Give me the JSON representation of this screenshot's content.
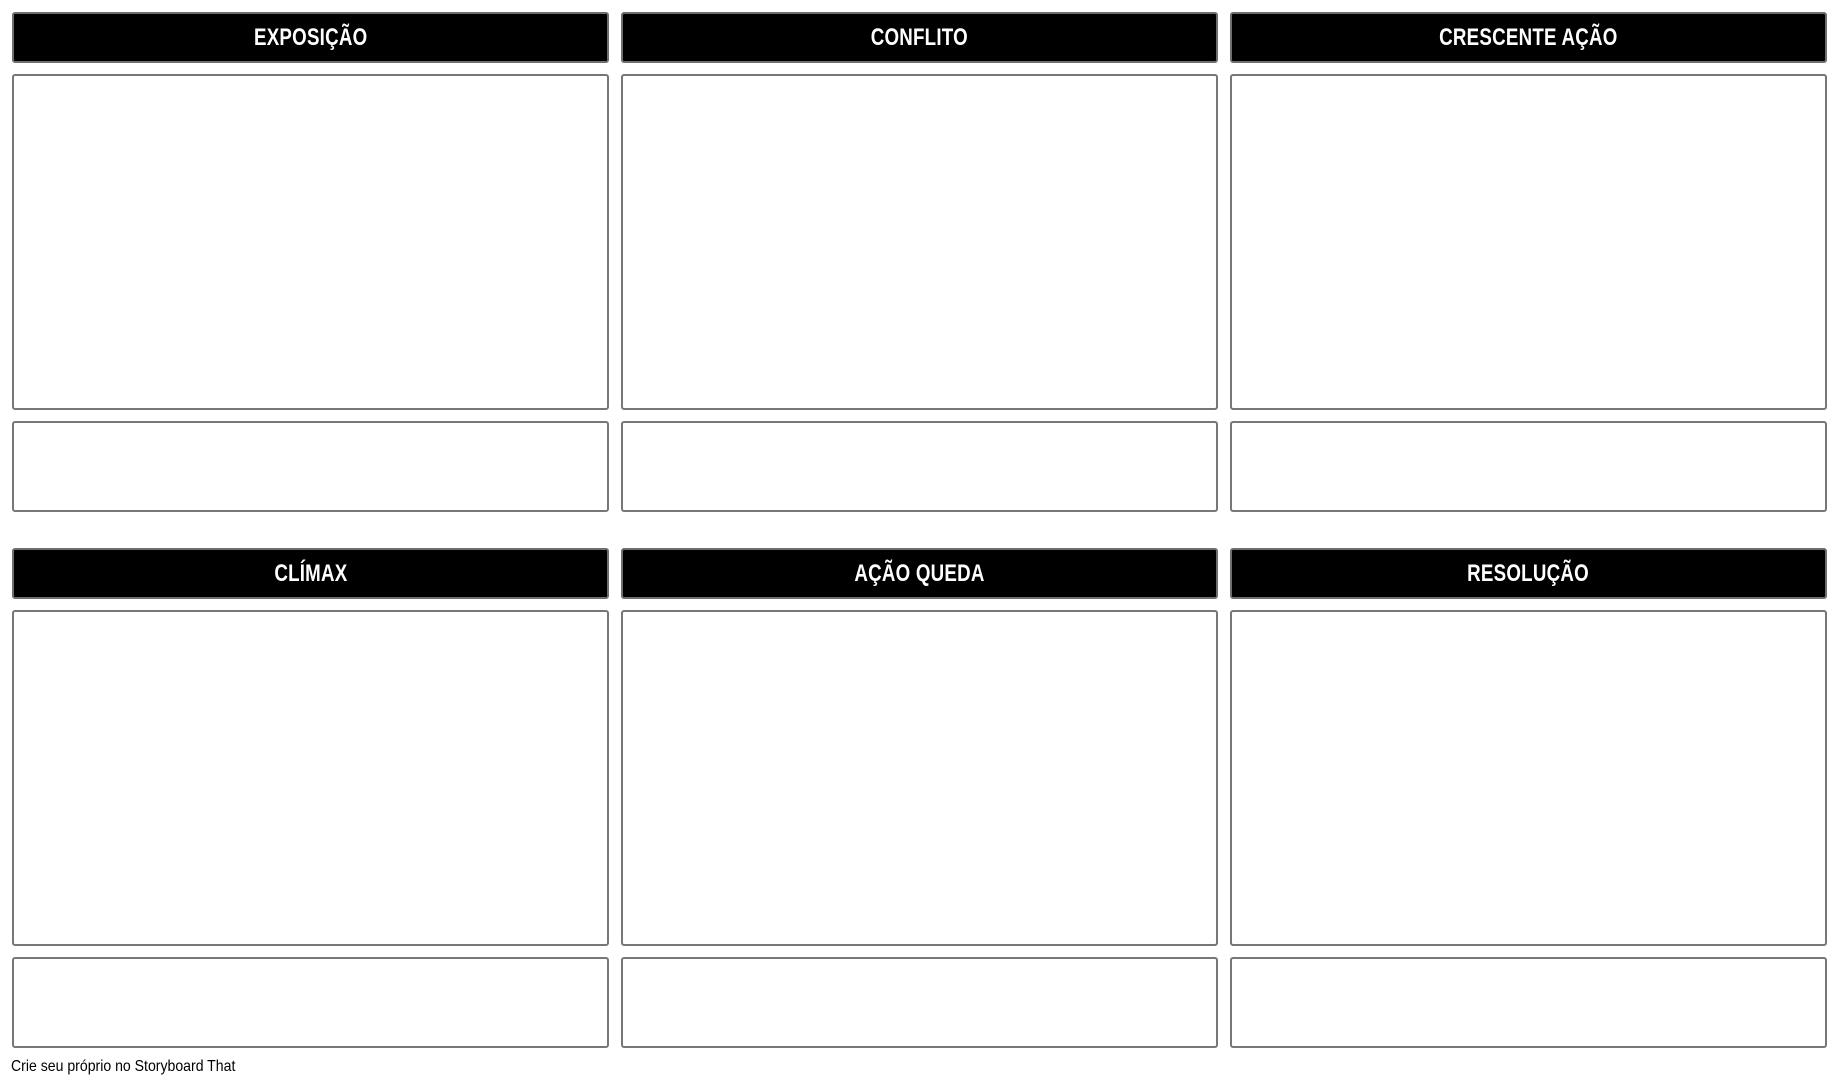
{
  "cells": [
    {
      "title": "EXPOSIÇÃO"
    },
    {
      "title": "CONFLITO"
    },
    {
      "title": "CRESCENTE AÇÃO"
    },
    {
      "title": "CLÍMAX"
    },
    {
      "title": "AÇÃO QUEDA"
    },
    {
      "title": "RESOLUÇÃO"
    }
  ],
  "footer": {
    "text": "Crie seu próprio no Storyboard That"
  },
  "colors": {
    "header_bg": "#000000",
    "header_text": "#ffffff",
    "border": "#777777"
  }
}
